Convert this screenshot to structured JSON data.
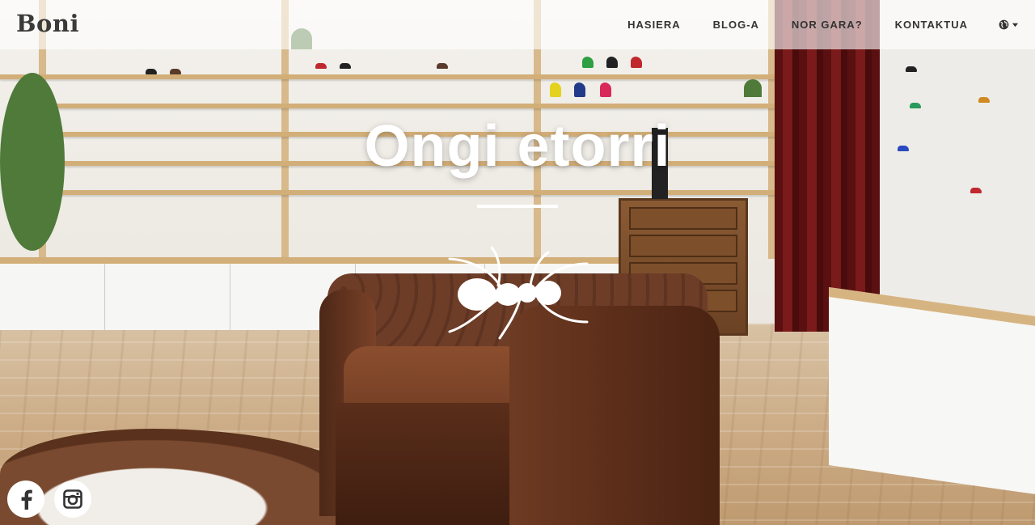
{
  "brand": {
    "name": "Boni"
  },
  "nav": {
    "items": [
      {
        "label": "HASIERA"
      },
      {
        "label": "BLOG-A"
      },
      {
        "label": "NOR GARA?"
      },
      {
        "label": "KONTAKTUA"
      }
    ],
    "language_icon": "globe-icon",
    "language_caret_icon": "caret-down-icon"
  },
  "hero": {
    "title": "Ongi etorri",
    "logo_icon": "ant-logo-icon"
  },
  "social": [
    {
      "icon": "facebook-icon"
    },
    {
      "icon": "instagram-icon"
    }
  ],
  "colors": {
    "nav_text": "#333333",
    "brand_text": "#3a3a3a",
    "hero_text": "#ffffff",
    "social_bg": "#ffffff",
    "social_icon": "#333333"
  }
}
